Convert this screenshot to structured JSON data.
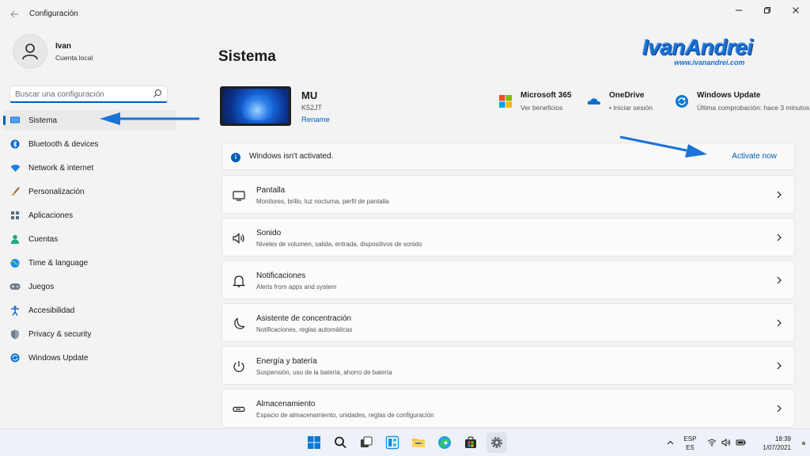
{
  "window": {
    "title": "Configuración",
    "controls": [
      "minimize",
      "restore",
      "close"
    ]
  },
  "profile": {
    "name": "Ivan",
    "subtitle": "Cuenta local"
  },
  "search": {
    "placeholder": "Buscar una configuración"
  },
  "sidebar": {
    "items": [
      {
        "label": "Sistema",
        "icon": "monitor-icon",
        "active": true
      },
      {
        "label": "Bluetooth & devices",
        "icon": "bluetooth-icon"
      },
      {
        "label": "Network & internet",
        "icon": "wifi-icon"
      },
      {
        "label": "Personalización",
        "icon": "brush-icon"
      },
      {
        "label": "Aplicaciones",
        "icon": "apps-icon"
      },
      {
        "label": "Cuentas",
        "icon": "person-icon"
      },
      {
        "label": "Time & language",
        "icon": "globe-clock-icon"
      },
      {
        "label": "Juegos",
        "icon": "gamepad-icon"
      },
      {
        "label": "Accesibilidad",
        "icon": "accessibility-icon"
      },
      {
        "label": "Privacy & security",
        "icon": "shield-icon"
      },
      {
        "label": "Windows Update",
        "icon": "update-icon"
      }
    ]
  },
  "main": {
    "title": "Sistema",
    "device": {
      "name": "MU",
      "model": "K52JT",
      "rename_label": "Rename"
    },
    "quick_links": [
      {
        "title": "Microsoft 365",
        "subtitle": "Ver beneficios",
        "icon": "microsoft-logo-icon"
      },
      {
        "title": "OneDrive",
        "subtitle": "• Iniciar sesión",
        "icon": "onedrive-cloud-icon"
      },
      {
        "title": "Windows Update",
        "subtitle": "Última comprobación: hace 3 minutos",
        "icon": "sync-icon"
      }
    ],
    "activation_banner": {
      "text": "Windows isn't activated.",
      "action_label": "Activate now"
    },
    "cards": [
      {
        "title": "Pantalla",
        "subtitle": "Monitores, brillo, luz nocturna, perfil de pantalla",
        "icon": "display-icon"
      },
      {
        "title": "Sonido",
        "subtitle": "Niveles de volumen, salida, entrada, dispositivos de sonido",
        "icon": "speaker-icon"
      },
      {
        "title": "Notificaciones",
        "subtitle": "Alerts from apps and system",
        "icon": "bell-icon"
      },
      {
        "title": "Asistente de concentración",
        "subtitle": "Notificaciones, reglas automáticas",
        "icon": "moon-icon"
      },
      {
        "title": "Energía y batería",
        "subtitle": "Suspensión, uso de la batería, ahorro de batería",
        "icon": "power-icon"
      },
      {
        "title": "Almacenamiento",
        "subtitle": "Espacio de almacenamiento, unidades, reglas de configuración",
        "icon": "storage-icon"
      }
    ]
  },
  "watermark": {
    "brand": "IvanAndrei",
    "url": "www.ivanandrei.com"
  },
  "taskbar": {
    "apps": [
      "windows-start-icon",
      "search-icon",
      "task-view-icon",
      "widgets-icon",
      "file-explorer-icon",
      "edge-icon",
      "store-icon",
      "settings-gear-icon"
    ],
    "tray": {
      "lang_top": "ESP",
      "lang_bottom": "ES",
      "time": "18:39",
      "date": "1/07/2021"
    }
  },
  "colors": {
    "accent": "#005fb8",
    "annotation_arrow": "#1a73d9"
  }
}
